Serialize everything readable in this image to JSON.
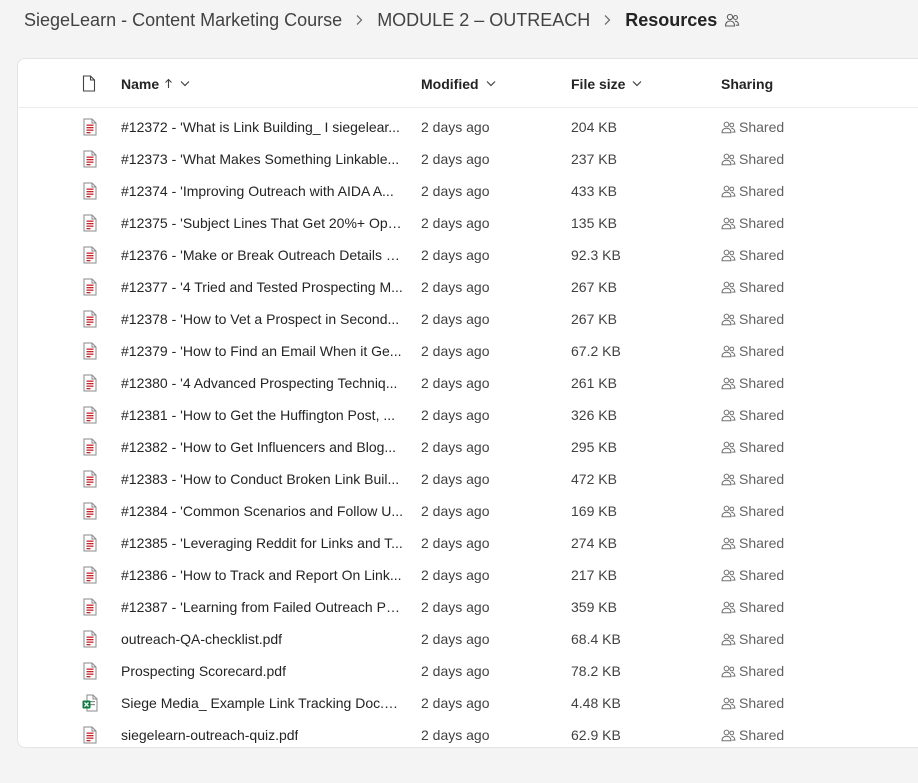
{
  "breadcrumb": {
    "items": [
      {
        "label": "SiegeLearn - Content Marketing Course"
      },
      {
        "label": "MODULE 2 – OUTREACH"
      },
      {
        "label": "Resources"
      }
    ]
  },
  "columns": {
    "name": "Name",
    "modified": "Modified",
    "file_size": "File size",
    "sharing": "Sharing"
  },
  "files": [
    {
      "name": "#12372 - 'What is Link Building_ I siegelearn.pdf",
      "display": "#12372 - 'What is Link Building_ I siegelear...",
      "type": "pdf",
      "modified": "2 days ago",
      "size": "204 KB",
      "sharing": "Shared"
    },
    {
      "name": "#12373 - 'What Makes Something Linkable.pdf",
      "display": "#12373 - 'What Makes Something Linkable...",
      "type": "pdf",
      "modified": "2 days ago",
      "size": "237 KB",
      "sharing": "Shared"
    },
    {
      "name": "#12374 - 'Improving Outreach with AIDA A.pdf",
      "display": "#12374 - 'Improving Outreach with AIDA A...",
      "type": "pdf",
      "modified": "2 days ago",
      "size": "433 KB",
      "sharing": "Shared"
    },
    {
      "name": "#12375 - 'Subject Lines That Get 20%+ Ope.pdf",
      "display": "#12375 - 'Subject Lines That Get 20%+ Ope...",
      "type": "pdf",
      "modified": "2 days ago",
      "size": "135 KB",
      "sharing": "Shared"
    },
    {
      "name": "#12376 - 'Make or Break Outreach Details S.pdf",
      "display": "#12376 - 'Make or Break Outreach Details S...",
      "type": "pdf",
      "modified": "2 days ago",
      "size": "92.3 KB",
      "sharing": "Shared"
    },
    {
      "name": "#12377 - '4 Tried and Tested Prospecting M.pdf",
      "display": "#12377 - '4 Tried and Tested Prospecting M...",
      "type": "pdf",
      "modified": "2 days ago",
      "size": "267 KB",
      "sharing": "Shared"
    },
    {
      "name": "#12378 - 'How to Vet a Prospect in Second.pdf",
      "display": "#12378 - 'How to Vet a Prospect in Second...",
      "type": "pdf",
      "modified": "2 days ago",
      "size": "267 KB",
      "sharing": "Shared"
    },
    {
      "name": "#12379 - 'How to Find an Email When it Ge.pdf",
      "display": "#12379 - 'How to Find an Email When it Ge...",
      "type": "pdf",
      "modified": "2 days ago",
      "size": "67.2 KB",
      "sharing": "Shared"
    },
    {
      "name": "#12380 - '4 Advanced Prospecting Techniq.pdf",
      "display": "#12380 - '4 Advanced Prospecting Techniq...",
      "type": "pdf",
      "modified": "2 days ago",
      "size": "261 KB",
      "sharing": "Shared"
    },
    {
      "name": "#12381 - 'How to Get the Huffington Post, .pdf",
      "display": "#12381 - 'How to Get the Huffington Post, ...",
      "type": "pdf",
      "modified": "2 days ago",
      "size": "326 KB",
      "sharing": "Shared"
    },
    {
      "name": "#12382 - 'How to Get Influencers and Blog.pdf",
      "display": "#12382 - 'How to Get Influencers and Blog...",
      "type": "pdf",
      "modified": "2 days ago",
      "size": "295 KB",
      "sharing": "Shared"
    },
    {
      "name": "#12383 - 'How to Conduct Broken Link Buil.pdf",
      "display": "#12383 - 'How to Conduct Broken Link Buil...",
      "type": "pdf",
      "modified": "2 days ago",
      "size": "472 KB",
      "sharing": "Shared"
    },
    {
      "name": "#12384 - 'Common Scenarios and Follow U.pdf",
      "display": "#12384 - 'Common Scenarios and Follow U...",
      "type": "pdf",
      "modified": "2 days ago",
      "size": "169 KB",
      "sharing": "Shared"
    },
    {
      "name": "#12385 - 'Leveraging Reddit for Links and T.pdf",
      "display": "#12385 - 'Leveraging Reddit for Links and T...",
      "type": "pdf",
      "modified": "2 days ago",
      "size": "274 KB",
      "sharing": "Shared"
    },
    {
      "name": "#12386 - 'How to Track and Report On Link.pdf",
      "display": "#12386 - 'How to Track and Report On Link...",
      "type": "pdf",
      "modified": "2 days ago",
      "size": "217 KB",
      "sharing": "Shared"
    },
    {
      "name": "#12387 - 'Learning from Failed Outreach Po.pdf",
      "display": "#12387 - 'Learning from Failed Outreach Po...",
      "type": "pdf",
      "modified": "2 days ago",
      "size": "359 KB",
      "sharing": "Shared"
    },
    {
      "name": "outreach-QA-checklist.pdf",
      "display": "outreach-QA-checklist.pdf",
      "type": "pdf",
      "modified": "2 days ago",
      "size": "68.4 KB",
      "sharing": "Shared"
    },
    {
      "name": "Prospecting Scorecard.pdf",
      "display": "Prospecting Scorecard.pdf",
      "type": "pdf",
      "modified": "2 days ago",
      "size": "78.2 KB",
      "sharing": "Shared"
    },
    {
      "name": "Siege Media_ Example Link Tracking Doc.xlsx",
      "display": "Siege Media_ Example Link Tracking Doc.xlsx",
      "type": "xlsx",
      "modified": "2 days ago",
      "size": "4.48 KB",
      "sharing": "Shared"
    },
    {
      "name": "siegelearn-outreach-quiz.pdf",
      "display": "siegelearn-outreach-quiz.pdf",
      "type": "pdf",
      "modified": "2 days ago",
      "size": "62.9 KB",
      "sharing": "Shared"
    }
  ],
  "sort": {
    "column": "Name",
    "direction": "ascending"
  },
  "colors": {
    "pdf_icon": "#c4262e",
    "excel_icon": "#107c41",
    "text": "#242424",
    "muted": "#616161"
  }
}
